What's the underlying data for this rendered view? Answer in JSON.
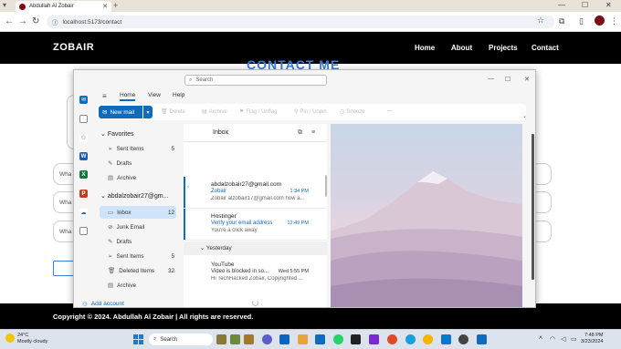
{
  "browser": {
    "tab_title": "Abdullah Al Zobair",
    "url": "localhost:5173/contact"
  },
  "site": {
    "logo": "ZOBAIR",
    "nav": [
      "Home",
      "About",
      "Projects",
      "Contact"
    ],
    "heading": "CONTACT ME",
    "field_placeholders": [
      "Wha",
      "Wha",
      "Wha"
    ],
    "footer": "Copyright © 2024. Abdullah Al Zobair | All rights are reserved."
  },
  "outlook": {
    "search_placeholder": "Search",
    "menu_tabs": [
      "Home",
      "View",
      "Help"
    ],
    "new_mail": "New mail",
    "ribbon_actions": [
      "Delete",
      "Archive",
      "Flag / Unflag",
      "Pin / Unpin",
      "Snooze"
    ],
    "favorites": {
      "label": "Favorites",
      "items": [
        {
          "label": "Sent Items",
          "count": "5"
        },
        {
          "label": "Drafts",
          "count": ""
        },
        {
          "label": "Archive",
          "count": ""
        }
      ]
    },
    "account": {
      "label": "abdalzobair27@gm...",
      "items": [
        {
          "label": "Inbox",
          "count": "12"
        },
        {
          "label": "Junk Email",
          "count": ""
        },
        {
          "label": "Drafts",
          "count": ""
        },
        {
          "label": "Sent Items",
          "count": "5"
        },
        {
          "label": "Deleted Items",
          "count": "32"
        },
        {
          "label": "Archive",
          "count": ""
        }
      ]
    },
    "add_account": "Add account",
    "list_title": "Inbox",
    "messages": [
      {
        "sender": "abdalzobair27@gmail.com",
        "subject": "Zobair",
        "time": "1:34 PM",
        "preview": "Zobair alzobair17@gmail.com how a..."
      },
      {
        "sender": "Hostinger",
        "subject": "Verify your email address",
        "time": "12:49 PM",
        "preview": "You're a click away"
      }
    ],
    "group_label": "Yesterday",
    "older_messages": [
      {
        "sender": "YouTube",
        "subject": "Video is blocked in so...",
        "time": "Wed 5:55 PM",
        "preview": "Hi TechHacked Zobair, Copyrighted ..."
      }
    ]
  },
  "taskbar": {
    "weather_temp": "24°C",
    "weather_desc": "Mostly cloudy",
    "search": "Search",
    "time": "7:48 PM",
    "date": "3/23/2024"
  },
  "colors": {
    "outlook_blue": "#0f6cbd",
    "site_black": "#000000",
    "heading_blue": "#3a7fd4"
  }
}
